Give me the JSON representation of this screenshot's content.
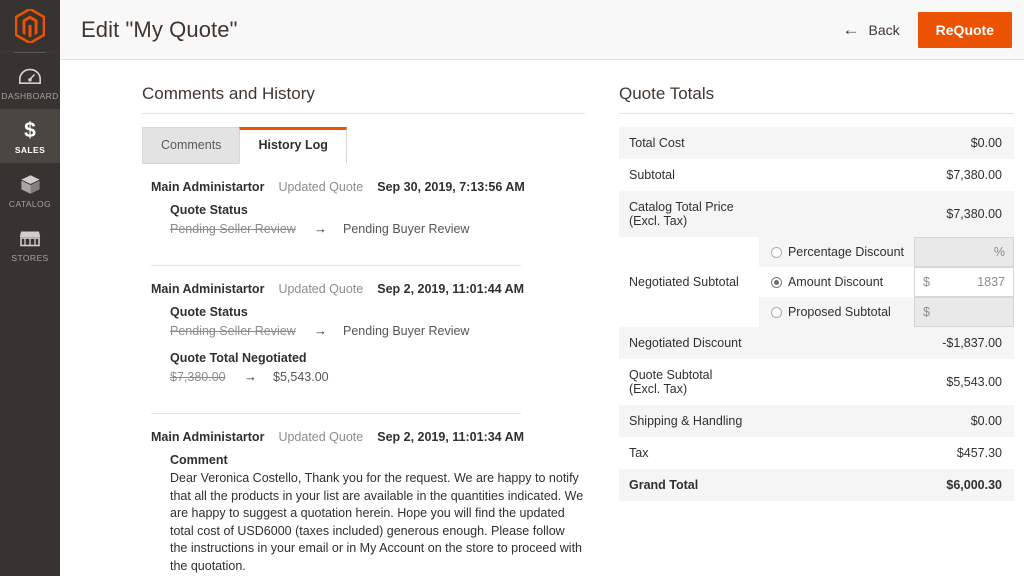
{
  "theme": {
    "accent": "#eb5202",
    "sidebar_bg": "#373330",
    "sidebar_active_bg": "#4a4641",
    "header_bg": "#f8f8f8",
    "row_shade": "#f5f5f5"
  },
  "sidebar": {
    "logo_name": "magento-logo",
    "items": [
      {
        "label": "Dashboard",
        "icon": "dashboard-gauge-icon",
        "active": false
      },
      {
        "label": "Sales",
        "icon": "dollar-sign-icon",
        "active": true
      },
      {
        "label": "Catalog",
        "icon": "box-icon",
        "active": false
      },
      {
        "label": "Stores",
        "icon": "storefront-icon",
        "active": false
      }
    ]
  },
  "header": {
    "title": "Edit \"My Quote\"",
    "back_label": "Back",
    "back_icon": "arrow-left-icon",
    "requote_label": "ReQuote"
  },
  "comments_section": {
    "title": "Comments and History",
    "tabs": [
      {
        "label": "Comments",
        "active": false
      },
      {
        "label": "History Log",
        "active": true
      }
    ],
    "entries": [
      {
        "author": "Main Administartor",
        "action": "Updated Quote",
        "date": "Sep 30, 2019, 7:13:56 AM",
        "changes": [
          {
            "label": "Quote Status",
            "old": "Pending Seller Review",
            "arrow": "→",
            "new": "Pending Buyer Review"
          }
        ],
        "comment_label": null,
        "comment": null
      },
      {
        "author": "Main Administartor",
        "action": "Updated Quote",
        "date": "Sep 2, 2019, 11:01:44 AM",
        "changes": [
          {
            "label": "Quote Status",
            "old": "Pending Seller Review",
            "arrow": "→",
            "new": "Pending Buyer Review"
          },
          {
            "label": "Quote Total Negotiated",
            "old": "$7,380.00",
            "arrow": "→",
            "new": "$5,543.00"
          }
        ],
        "comment_label": null,
        "comment": null
      },
      {
        "author": "Main Administartor",
        "action": "Updated Quote",
        "date": "Sep 2, 2019, 11:01:34 AM",
        "changes": [],
        "comment_label": "Comment",
        "comment": "Dear Veronica Costello, Thank you for the request. We are happy to notify that all the products in your list are available in the quantities indicated. We are happy to suggest a quotation herein. Hope you will find the updated total cost of USD6000 (taxes included) generous enough. Please follow the instructions in your email or in My Account on the store to proceed with the quotation."
      }
    ]
  },
  "quote_totals": {
    "title": "Quote Totals",
    "rows_top": [
      {
        "label": "Total Cost",
        "value": "$0.00",
        "shade": true
      },
      {
        "label": "Subtotal",
        "value": "$7,380.00",
        "shade": false
      },
      {
        "label": "Catalog Total Price (Excl. Tax)",
        "value": "$7,380.00",
        "shade": true
      }
    ],
    "negotiated": {
      "label": "Negotiated Subtotal",
      "options": [
        {
          "label": "Percentage Discount",
          "selected": false,
          "addon": "",
          "suffix": "%",
          "value": "",
          "placeholder": "",
          "enabled": false,
          "shaded": true
        },
        {
          "label": "Amount Discount",
          "selected": true,
          "addon": "$",
          "suffix": "",
          "value": "1837",
          "placeholder": "",
          "enabled": true,
          "shaded": false
        },
        {
          "label": "Proposed Subtotal",
          "selected": false,
          "addon": "$",
          "suffix": "",
          "value": "",
          "placeholder": "",
          "enabled": false,
          "shaded": true
        }
      ]
    },
    "rows_bottom": [
      {
        "label": "Negotiated Discount",
        "value": "-$1,837.00",
        "shade": true,
        "grand": false
      },
      {
        "label": "Quote Subtotal (Excl. Tax)",
        "value": "$5,543.00",
        "shade": false,
        "grand": false
      },
      {
        "label": "Shipping & Handling",
        "value": "$0.00",
        "shade": true,
        "grand": false
      },
      {
        "label": "Tax",
        "value": "$457.30",
        "shade": false,
        "grand": false
      },
      {
        "label": "Grand Total",
        "value": "$6,000.30",
        "shade": true,
        "grand": true
      }
    ]
  }
}
